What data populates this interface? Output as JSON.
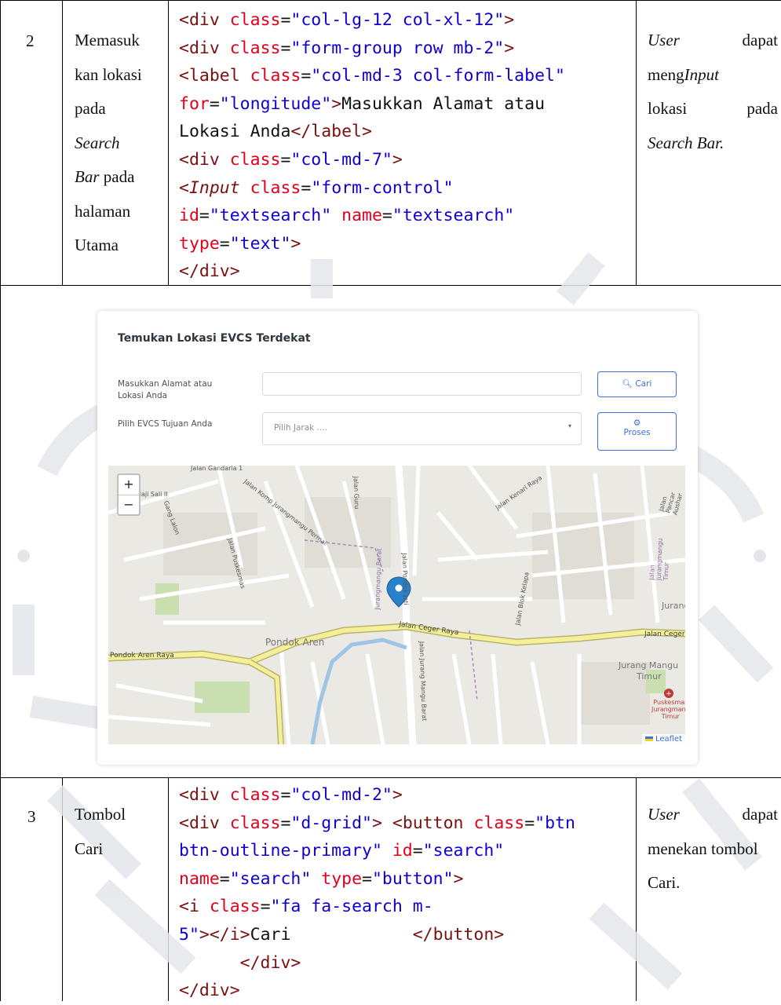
{
  "row2": {
    "number": "2",
    "description_lines": [
      {
        "text": "Memasuk",
        "italic": false
      },
      {
        "text": "kan lokasi",
        "italic": false
      },
      {
        "text": "pada",
        "italic": false
      },
      {
        "text": "Search",
        "italic": true
      },
      {
        "text": "Bar pada",
        "italic": false
      },
      {
        "text": "halaman",
        "italic": false
      },
      {
        "text": "Utama",
        "italic": false
      }
    ],
    "result": {
      "line1_a": "User",
      "line1_b": "dapat",
      "line2_a": "meng",
      "line2_b": "Input",
      "line3_a": "lokasi",
      "line3_b": "pada",
      "line4": "Search Bar."
    }
  },
  "row3": {
    "number": "3",
    "description_lines": [
      "Tombol",
      "Cari"
    ],
    "result": {
      "line1_a": "User",
      "line1_b": "dapat",
      "line2": "menekan tombol",
      "line3": "Cari."
    }
  },
  "screenshot": {
    "title": "Temukan Lokasi EVCS Terdekat",
    "address_label": "Masukkan Alamat atau Lokasi Anda",
    "address_label_l1": "Masukkan Alamat atau",
    "address_label_l2": "Lokasi Anda",
    "address_value": "",
    "search_button": "Cari",
    "evcs_label": "Pilih EVCS Tujuan Anda",
    "select_placeholder": "Pilih Jarak ....",
    "process_button": "Proses",
    "zoom_in": "+",
    "zoom_out": "−",
    "attribution": "Leaflet",
    "map_labels": {
      "pondok_aren": "Pondok Aren",
      "pondok_aren_raya": "Pondok Aren Raya",
      "jalan_ceger_raya": "Jalan Ceger Raya",
      "jalan_ceger_raya_2": "Jalan Ceger",
      "jurang_mangu": "Jurang Mangu",
      "timur": "Timur",
      "jurang_short": "Jurang",
      "puskesmas": "Puskesmas",
      "puskesmas_2": "Jurangmang",
      "puskesmas_3": "Timur",
      "haji_sali": "Haji Sali II",
      "gang_lalon": "Gang Lalon",
      "jalan_gandaria": "Jalan Gandaria 1",
      "jalan_pondok_jati": "Jalan Pondok Jati",
      "jalan_blok_kelapa": "Jalan Blok Kelapa",
      "jalan_kenari": "Jalan Kenari Raya",
      "jalan_puskesmas": "Jalan Puskesmas",
      "jalan_komp": "Jalan Komp Jurangmangu Permai",
      "jalan_jurang_barat": "Jalan Jurang Mangu Barat",
      "jalan_guru": "Jalan Guru",
      "jurangmangu_barat": "Jurangmangu Barat",
      "pancar_aushar": "Jalan Pancar Aushar",
      "jalan_jurangmangu_timur": "Jalan Jurangmangu Timur"
    }
  },
  "colors": {
    "accent": "#3d6fe0",
    "tag": "#7a1010",
    "attr": "#e0001b",
    "value": "#1000d0"
  }
}
